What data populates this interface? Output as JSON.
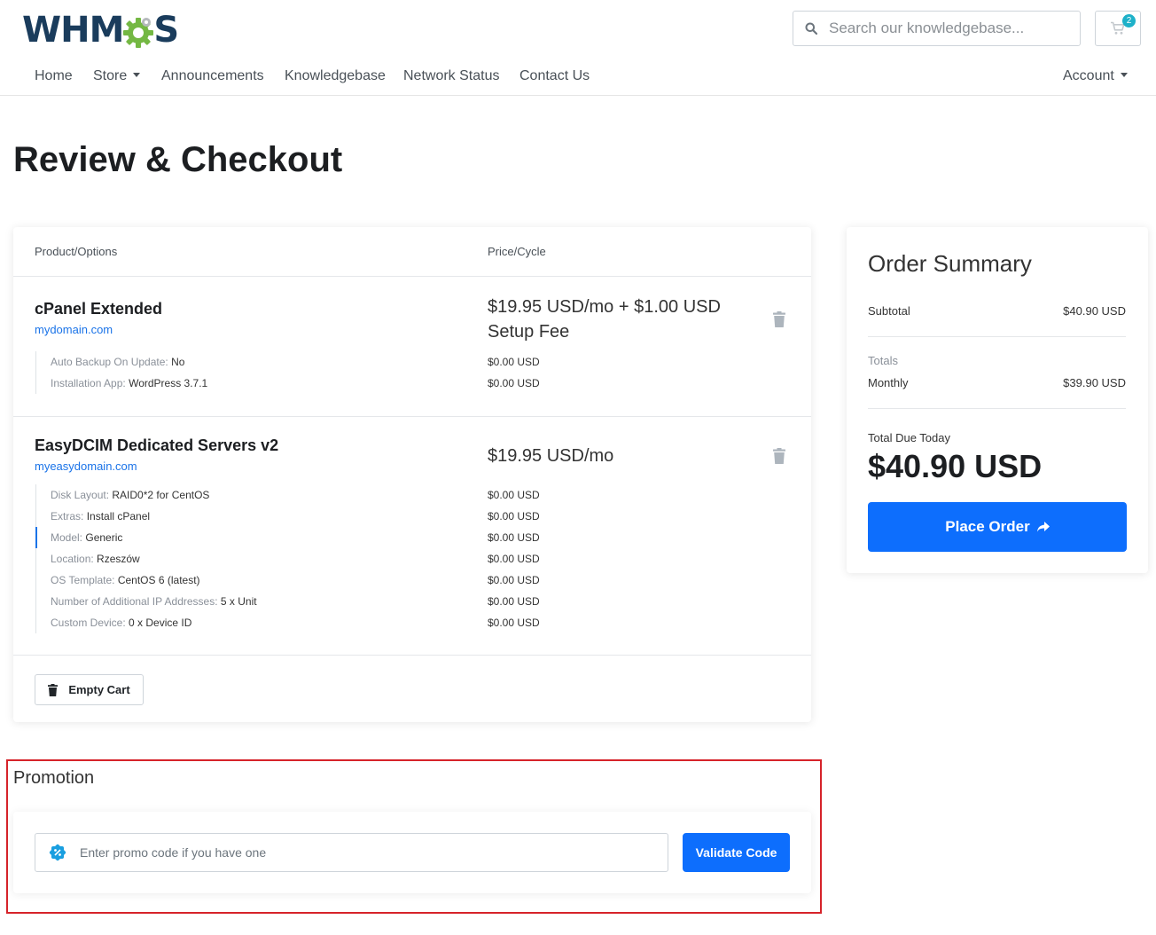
{
  "header": {
    "logo": {
      "text_left": "WHM",
      "text_right": "S"
    },
    "search": {
      "placeholder": "Search our knowledgebase..."
    },
    "cart": {
      "count": "2"
    }
  },
  "nav": {
    "items": [
      {
        "label": "Home"
      },
      {
        "label": "Store"
      },
      {
        "label": "Announcements"
      },
      {
        "label": "Knowledgebase"
      },
      {
        "label": "Network Status"
      },
      {
        "label": "Contact Us"
      }
    ],
    "account": "Account"
  },
  "page": {
    "title": "Review & Checkout"
  },
  "cart_table": {
    "col_product": "Product/Options",
    "col_price": "Price/Cycle",
    "products": [
      {
        "name": "cPanel Extended",
        "domain": "mydomain.com",
        "price": "$19.95 USD/mo + $1.00 USD Setup Fee",
        "options": [
          {
            "label": "Auto Backup On Update:",
            "value": "No",
            "price": "$0.00 USD"
          },
          {
            "label": "Installation App:",
            "value": "WordPress 3.7.1",
            "price": "$0.00 USD"
          }
        ]
      },
      {
        "name": "EasyDCIM Dedicated Servers v2",
        "domain": "myeasydomain.com",
        "price": "$19.95 USD/mo",
        "options": [
          {
            "label": "Disk Layout:",
            "value": "RAID0*2 for CentOS",
            "price": "$0.00 USD"
          },
          {
            "label": "Extras:",
            "value": "Install cPanel",
            "price": "$0.00 USD"
          },
          {
            "label": "Model:",
            "value": "Generic",
            "price": "$0.00 USD"
          },
          {
            "label": "Location:",
            "value": "Rzeszów",
            "price": "$0.00 USD"
          },
          {
            "label": "OS Template:",
            "value": "CentOS 6 (latest)",
            "price": "$0.00 USD"
          },
          {
            "label": "Number of Additional IP Addresses:",
            "value": "5 x Unit",
            "price": "$0.00 USD"
          },
          {
            "label": "Custom Device:",
            "value": "0 x Device ID",
            "price": "$0.00 USD"
          }
        ]
      }
    ],
    "empty_cart_label": "Empty Cart"
  },
  "summary": {
    "title": "Order Summary",
    "subtotal_label": "Subtotal",
    "subtotal_value": "$40.90 USD",
    "totals_label": "Totals",
    "monthly_label": "Monthly",
    "monthly_value": "$39.90 USD",
    "due_label": "Total Due Today",
    "due_amount": "$40.90 USD",
    "place_order_label": "Place Order"
  },
  "promotion": {
    "title": "Promotion",
    "placeholder": "Enter promo code if you have one",
    "validate_label": "Validate Code"
  },
  "colors": {
    "primary": "#0d6efd",
    "link": "#1a73e8",
    "logo_dark": "#1a3c5c",
    "logo_green": "#74b843",
    "badge": "#1eb1c9",
    "highlight_outline": "#d6232a"
  }
}
